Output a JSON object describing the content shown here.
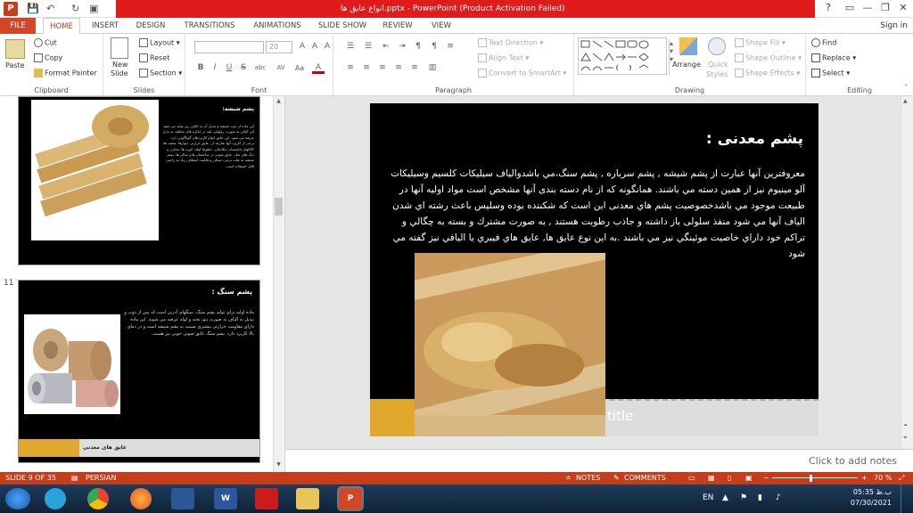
{
  "window": {
    "title": "انواع عایق ها.pptx - PowerPoint (Product Activation Failed)",
    "help": "?",
    "minimize": "—",
    "restore": "❐",
    "close": "✕"
  },
  "tabs": [
    "FILE",
    "HOME",
    "INSERT",
    "DESIGN",
    "TRANSITIONS",
    "ANIMATIONS",
    "SLIDE SHOW",
    "REVIEW",
    "VIEW"
  ],
  "signin": "Sign in",
  "ribbon": {
    "clipboard": {
      "label": "Clipboard",
      "paste": "Paste",
      "cut": "Cut",
      "copy": "Copy",
      "format_painter": "Format Painter"
    },
    "slides": {
      "label": "Slides",
      "new_slide": "New",
      "new_slide2": "Slide",
      "layout": "Layout",
      "reset": "Reset",
      "section": "Section"
    },
    "font": {
      "label": "Font",
      "size": "20",
      "bold": "B",
      "italic": "I",
      "underline": "U",
      "strike": "S",
      "shadow": "abc",
      "spacing": "AV",
      "case": "Aa",
      "clear": "A"
    },
    "paragraph": {
      "label": "Paragraph",
      "text_direction": "Text Direction",
      "align_text": "Align Text",
      "convert": "Convert to SmartArt"
    },
    "drawing": {
      "label": "Drawing",
      "arrange": "Arrange",
      "quick_styles": "Quick",
      "quick_styles2": "Styles",
      "shape_fill": "Shape Fill",
      "shape_outline": "Shape Outline",
      "shape_effects": "Shape Effects"
    },
    "editing": {
      "label": "Editing",
      "find": "Find",
      "replace": "Replace",
      "select": "Select"
    }
  },
  "thumbnails": [
    {
      "number": "",
      "heading": "پشم شیشه:",
      "body": "این ماده از ذوب شیشه و تبدیل آن به الیاف ریز تولید می شود این الیاف به صورت رولهایی بلند در اندازه های مختلف به بازار عرضه می شود. این عایق انواع کاربردهای گوناگونی دارد. برخی از کاربرد آنها عبارتند از: عایق حرارتی دیوارها، سقف ها، کانالهای تاسیسات مکانیکی، خطوط لوله، کوره ها، مخازن و دیگ های بخار. عایق صوتی در ساختمان ها و سالن ها. پشم شیشه به علت نرمی، سبکی و قابلیت انعطاف زیاد به راحتی قابل استفاده است."
    },
    {
      "number": "11",
      "heading": "پشم سنگ :",
      "body": "ماده اولیه برای تولید پشم سنگ، سنگهای آذرین است که پس از ذوب و تبدیل به الیاف به صورت پتو، تخته و لوله عرضه می شوند. این ماده دارای مقاومت حرارتی بیشتری نسبت به پشم شیشه است و در دمای بالا کاربرد دارد. پشم سنگ عایق صوتی خوبی نیز هست.",
      "footer_text": "عایق های معدنی"
    }
  ],
  "slide": {
    "title": "پشم معدنی :",
    "body": "معروفترين آنها عبارت از پشم شیشه , پشم سرباره , پشم سنگ،مي باشدوالیاف سیلیکات کلسیم وسیلیکات آلو مینیوم نیز از همين دسته مي باشند. همانگونه که از نام دسته بندی آنها مشخص است مواد اولیه آنها در طبیعت موجود مي باشدخصوصیت پشم هاي معدنی این است که شکننده بوده وسلیس باعث رشته اي شدن الیاف آنها مي شود منفذ سلولی باز داشته و جاذب رطوبت هستند , به صورت مشترك و بسته به چگالي و تراکم خود داراي خاصیت موئینگي نیز مي باشند .به اين نوع عايق ها, عايق هاي فیبري يا الیافي نيز گفته مي شود",
    "placeholder_title": "title"
  },
  "notes_placeholder": "Click to add notes",
  "statusbar": {
    "slide_info": "SLIDE 9 OF 35",
    "language": "PERSIAN",
    "notes": "NOTES",
    "comments": "COMMENTS",
    "zoom": "70 %",
    "zoom_minus": "−",
    "zoom_plus": "+"
  },
  "taskbar": {
    "lang": "EN",
    "time": "05:35 ب.ظ",
    "date": "07/30/2021"
  },
  "colors": {
    "accent": "#c43e1c",
    "title_bar_red": "#e01b1b",
    "slide_gold": "#e0a92e",
    "taskbar": "#17324f"
  }
}
